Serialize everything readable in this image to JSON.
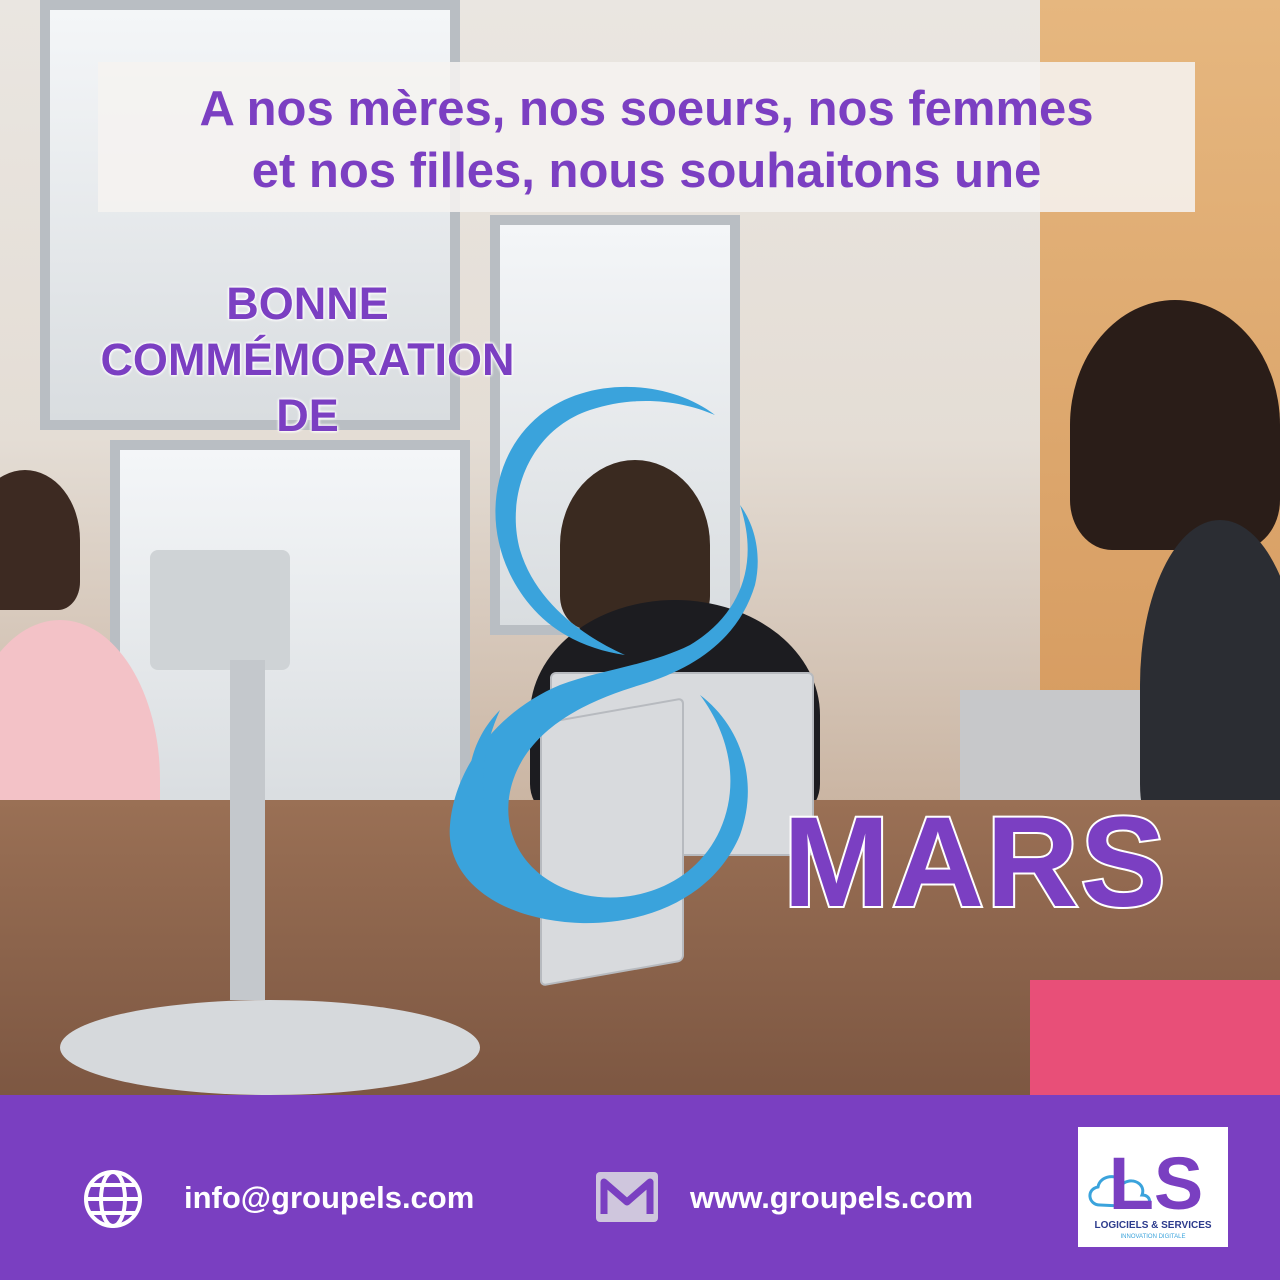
{
  "headline": {
    "line1": "A nos mères, nos soeurs, nos femmes",
    "line2": "et nos filles, nous souhaitons une"
  },
  "greeting": {
    "line1": "BONNE",
    "line2": "COMMÉMORATION",
    "line3": "DE"
  },
  "date": {
    "day": "8",
    "month": "MARS"
  },
  "footer": {
    "email": "info@groupels.com",
    "website": "www.groupels.com",
    "email_icon": "globe-icon",
    "website_icon": "mail-icon"
  },
  "logo": {
    "letters": "LS",
    "line1": "LOGICIELS & SERVICES",
    "line2": "INNOVATION DIGITALE"
  },
  "colors": {
    "purple": "#7a3fc1",
    "blue": "#3aa3dc"
  }
}
